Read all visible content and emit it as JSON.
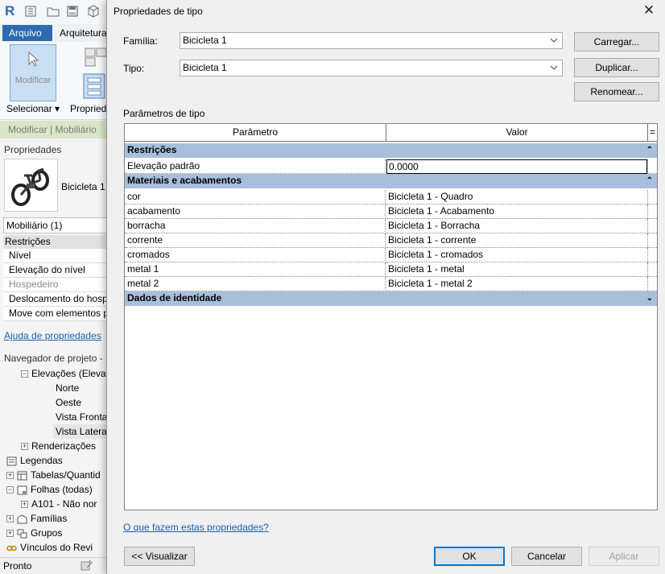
{
  "revit": {
    "logo": "R",
    "tabs": {
      "file": "Arquivo",
      "architecture": "Arquitetura"
    },
    "ribbon": {
      "modify": "Modificar",
      "select": "Selecionar",
      "select_arrow": "▾",
      "properties_short": "Propried"
    },
    "context_bar": "Modificar | Mobiliário",
    "properties": {
      "heading": "Propriedades",
      "type_name": "Bicicleta 1",
      "category_filter": "Mobiliário (1)",
      "rows": [
        {
          "label": "Restrições",
          "kind": "group"
        },
        {
          "label": "Nível",
          "kind": "item"
        },
        {
          "label": "Elevação do nível",
          "kind": "item"
        },
        {
          "label": "Hospedeiro",
          "kind": "dim"
        },
        {
          "label": "Deslocamento do hosp",
          "kind": "item"
        },
        {
          "label": "Move com elementos p",
          "kind": "item"
        }
      ],
      "help_link": "Ajuda de propriedades"
    },
    "browser": {
      "heading": "Navegador de projeto -",
      "items": [
        {
          "label": "Elevações (Eleva",
          "exp": "−",
          "icon": ""
        },
        {
          "label": "Norte",
          "exp": "",
          "icon": ""
        },
        {
          "label": "Oeste",
          "exp": "",
          "icon": ""
        },
        {
          "label": "Vista Fronta",
          "exp": "",
          "icon": ""
        },
        {
          "label": "Vista Lateral",
          "exp": "",
          "icon": ""
        },
        {
          "label": "Renderizações",
          "exp": "+",
          "icon": ""
        },
        {
          "label": "Legendas",
          "exp": "",
          "icon": "legend-icon"
        },
        {
          "label": "Tabelas/Quantid",
          "exp": "+",
          "icon": "schedule-icon"
        },
        {
          "label": "Folhas (todas)",
          "exp": "−",
          "icon": "sheet-icon"
        },
        {
          "label": "A101 - Não nor",
          "exp": "+",
          "icon": ""
        },
        {
          "label": "Famílias",
          "exp": "+",
          "icon": "family-icon"
        },
        {
          "label": "Grupos",
          "exp": "+",
          "icon": "group-icon"
        },
        {
          "label": "Vínculos do Revi",
          "exp": "",
          "icon": "link-icon"
        }
      ]
    },
    "status": "Pronto"
  },
  "dialog": {
    "title": "Propriedades de tipo",
    "close_glyph": "✕",
    "family_label": "Família:",
    "family_value": "Bicicleta 1",
    "type_label": "Tipo:",
    "type_value": "Bicicleta 1",
    "load_button": "Carregar...",
    "duplicate_button": "Duplicar...",
    "rename_button": "Renomear...",
    "params_title": "Parâmetros de tipo",
    "grid": {
      "col_param": "Parâmetro",
      "col_value": "Valor",
      "col_eq": "=",
      "rows": [
        {
          "kind": "section",
          "label": "Restrições",
          "indicator": "⌃"
        },
        {
          "kind": "param",
          "name": "Elevação padrão",
          "value": "0.0000",
          "active": true
        },
        {
          "kind": "section",
          "label": "Materiais e acabamentos",
          "indicator": "⌃"
        },
        {
          "kind": "param",
          "name": "cor",
          "value": "Bicicleta 1 - Quadro"
        },
        {
          "kind": "param",
          "name": "acabamento",
          "value": "Bicicleta 1 - Acabamento"
        },
        {
          "kind": "param",
          "name": "borracha",
          "value": "Bicicleta 1 - Borracha"
        },
        {
          "kind": "param",
          "name": "corrente",
          "value": "Bicicleta 1 - corrente"
        },
        {
          "kind": "param",
          "name": "cromados",
          "value": "Bicicleta 1 - cromados"
        },
        {
          "kind": "param",
          "name": "metal 1",
          "value": "Bicicleta 1 - metal"
        },
        {
          "kind": "param",
          "name": "metal 2",
          "value": "Bicicleta 1 - metal 2"
        },
        {
          "kind": "section",
          "label": "Dados de identidade",
          "indicator": "⌄"
        }
      ]
    },
    "help_link": "O que fazem estas propriedades?",
    "preview_button": "<< Visualizar",
    "ok_button": "OK",
    "cancel_button": "Cancelar",
    "apply_button": "Aplicar"
  }
}
